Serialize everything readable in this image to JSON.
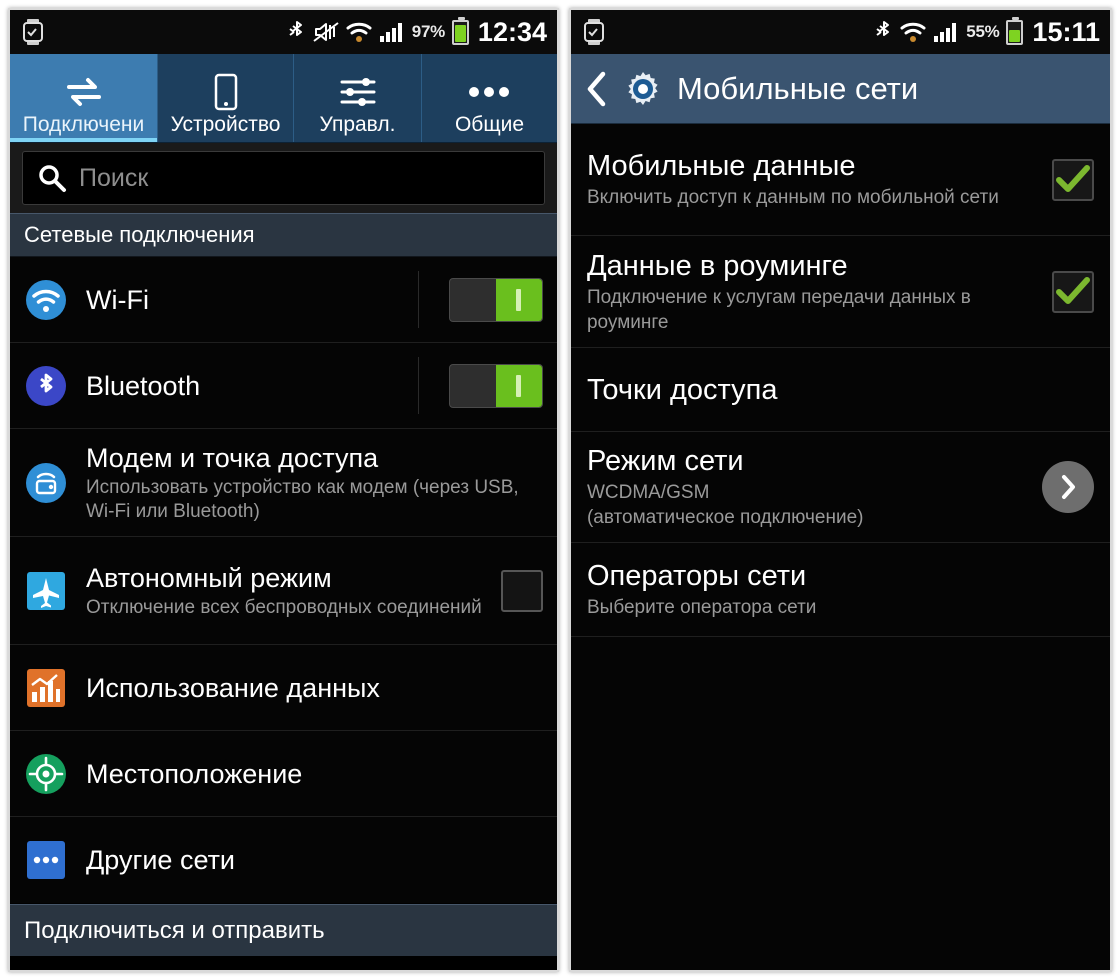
{
  "left_phone": {
    "status_bar": {
      "watch_icon": "smartwatch-icon",
      "icons": [
        "bluetooth-icon",
        "sound-muted-icon",
        "wifi-icon",
        "signal-bars-icon"
      ],
      "battery_percent": "97%",
      "battery_level": 97,
      "clock": "12:34"
    },
    "tabs": [
      {
        "label": "Подключени",
        "icon": "connections-arrows-icon",
        "active": true
      },
      {
        "label": "Устройство",
        "icon": "phone-device-icon",
        "active": false
      },
      {
        "label": "Управл.",
        "icon": "sliders-controls-icon",
        "active": false
      },
      {
        "label": "Общие",
        "icon": "more-dots-icon",
        "active": false
      }
    ],
    "search": {
      "icon": "search-icon",
      "placeholder": "Поиск",
      "value": ""
    },
    "section_header": "Сетевые подключения",
    "items": [
      {
        "title": "Wi-Fi",
        "subtitle": "",
        "icon": "wifi-icon",
        "control": "toggle",
        "state": "on"
      },
      {
        "title": "Bluetooth",
        "subtitle": "",
        "icon": "bluetooth-icon",
        "control": "toggle",
        "state": "on"
      },
      {
        "title": "Модем и точка доступа",
        "subtitle": "Использовать устройство как модем (через USB, Wi-Fi или Bluetooth)",
        "icon": "tethering-hotspot-icon",
        "control": "none",
        "state": ""
      },
      {
        "title": "Автономный режим",
        "subtitle": "Отключение всех беспроводных соединений",
        "icon": "airplane-icon",
        "control": "checkbox",
        "state": "off"
      },
      {
        "title": "Использование данных",
        "subtitle": "",
        "icon": "data-usage-chart-icon",
        "control": "none",
        "state": ""
      },
      {
        "title": "Местоположение",
        "subtitle": "",
        "icon": "location-target-icon",
        "control": "none",
        "state": ""
      },
      {
        "title": "Другие сети",
        "subtitle": "",
        "icon": "more-networks-dots-icon",
        "control": "none",
        "state": ""
      }
    ],
    "bottom_bar": "Подключиться и отправить"
  },
  "right_phone": {
    "status_bar": {
      "watch_icon": "smartwatch-icon",
      "icons": [
        "bluetooth-icon",
        "wifi-icon",
        "signal-bars-icon"
      ],
      "battery_percent": "55%",
      "battery_level": 55,
      "clock": "15:11"
    },
    "header": {
      "back_icon": "back-chevron-icon",
      "app_icon": "settings-gear-icon",
      "title": "Мобильные сети"
    },
    "items": [
      {
        "title": "Мобильные данные",
        "subtitle": "Включить доступ к данным по мобильной сети",
        "control": "checkbox",
        "state": "on"
      },
      {
        "title": "Данные в роуминге",
        "subtitle": "Подключение к услугам передачи данных в роуминге",
        "control": "checkbox",
        "state": "on"
      },
      {
        "title": "Точки доступа",
        "subtitle": "",
        "control": "none",
        "state": ""
      },
      {
        "title": "Режим сети",
        "subtitle": "WCDMA/GSM\n(автоматическое подключение)",
        "control": "arrow",
        "state": ""
      },
      {
        "title": "Операторы сети",
        "subtitle": "Выберите оператора сети",
        "control": "none",
        "state": ""
      }
    ]
  },
  "colors": {
    "accent_blue": "#3d7cb0",
    "tabbar_blue": "#1d3f5e",
    "header_blue": "#3a5470",
    "section_slate": "#2a3541",
    "toggle_green": "#6abf1e",
    "check_green": "#7cb82f",
    "background_black": "#050505",
    "status_black": "#0b0b0b"
  }
}
